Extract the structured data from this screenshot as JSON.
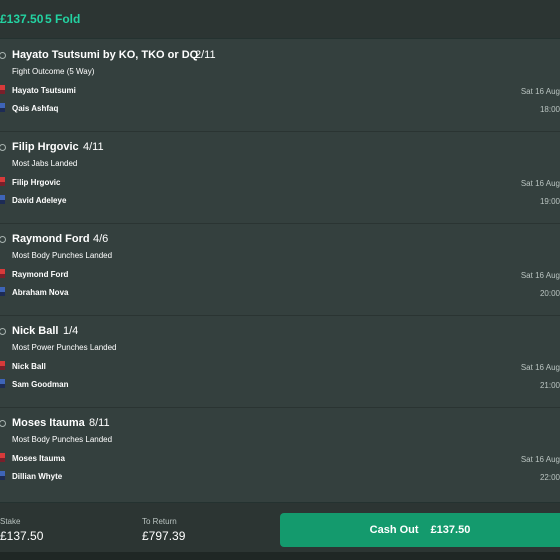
{
  "header": {
    "amount": "£137.50",
    "bet_type": "5 Fold"
  },
  "legs": [
    {
      "selection": "Hayato Tsutsumi by KO, TKO or DQ",
      "odds": "2/11",
      "market": "Fight Outcome (5 Way)",
      "home": "Hayato Tsutsumi",
      "away": "Qais Ashfaq",
      "date": "Sat 16 Aug",
      "time": "18:00"
    },
    {
      "selection": "Filip Hrgovic",
      "odds": "4/11",
      "market": "Most Jabs Landed",
      "home": "Filip Hrgovic",
      "away": "David Adeleye",
      "date": "Sat 16 Aug",
      "time": "19:00"
    },
    {
      "selection": "Raymond Ford",
      "odds": "4/6",
      "market": "Most Body Punches Landed",
      "home": "Raymond Ford",
      "away": "Abraham Nova",
      "date": "Sat 16 Aug",
      "time": "20:00"
    },
    {
      "selection": "Nick Ball",
      "odds": "1/4",
      "market": "Most Power Punches Landed",
      "home": "Nick Ball",
      "away": "Sam Goodman",
      "date": "Sat 16 Aug",
      "time": "21:00"
    },
    {
      "selection": "Moses Itauma",
      "odds": "8/11",
      "market": "Most Body Punches Landed",
      "home": "Moses Itauma",
      "away": "Dillian Whyte",
      "date": "Sat 16 Aug",
      "time": "22:00"
    }
  ],
  "footer": {
    "stake_label": "Stake",
    "stake_value": "£137.50",
    "return_label": "To Return",
    "return_value": "£797.39",
    "cashout_label": "Cash Out",
    "cashout_value": "£137.50"
  },
  "colors": {
    "accent": "#23d3a2",
    "cashout_bg": "#149a6d",
    "panel_bg": "#34403e",
    "header_bg": "#2c3533"
  }
}
